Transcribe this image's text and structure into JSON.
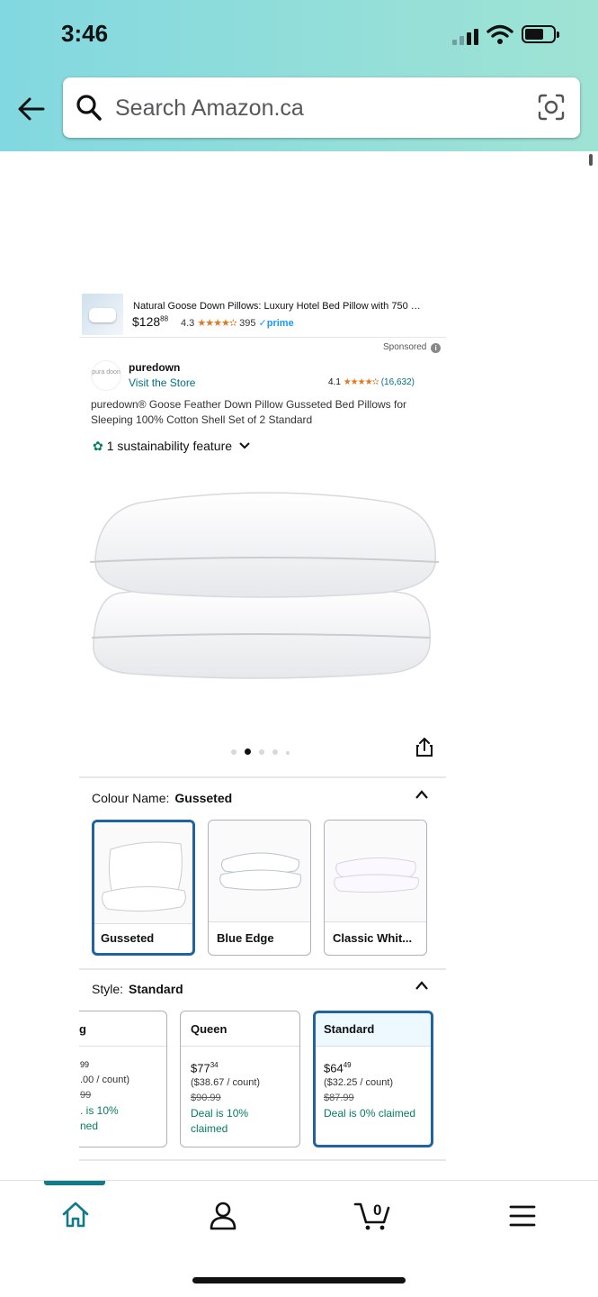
{
  "status_bar": {
    "time": "3:46"
  },
  "search": {
    "placeholder": "Search Amazon.ca"
  },
  "sponsored_ad": {
    "title": "Natural Goose Down Pillows: Luxury Hotel Bed Pillow with 750 …",
    "price_main": "$128",
    "price_cents": "88",
    "rating": "4.3",
    "stars": "★★★★✫",
    "review_count": "395",
    "prime_label": "✓prime"
  },
  "sponsored_label": "Sponsored",
  "brand": {
    "logo_text": "pura doon",
    "name": "puredown",
    "store_link": "Visit the Store",
    "rating": "4.1",
    "stars": "★★★★✫",
    "review_count": "(16,632)"
  },
  "product": {
    "title": "puredown® Goose Feather Down Pillow Gusseted Bed Pillows for Sleeping 100% Cotton Shell Set of 2 Standard",
    "sustainability": "1 sustainability feature"
  },
  "image_carousel": {
    "count": 5,
    "active_index": 1
  },
  "colour": {
    "label": "Colour Name:",
    "selected": "Gusseted",
    "options": [
      "Gusseted",
      "Blue Edge",
      "Classic Whit..."
    ]
  },
  "style": {
    "label": "Style:",
    "selected": "Standard",
    "options": [
      {
        "name": "g",
        "price": "99",
        "unit": ".00 / count)",
        "list": "99",
        "deal1": ". is 10%",
        "deal2": "ned"
      },
      {
        "name": "Queen",
        "price": "$77",
        "cents": "34",
        "unit": "($38.67 / count)",
        "list": "$90.99",
        "deal1": "Deal is 10%",
        "deal2": "claimed"
      },
      {
        "name": "Standard",
        "price": "$64",
        "cents": "49",
        "unit": "($32.25 / count)",
        "list": "$87.99",
        "deal1": "Deal is 0% claimed",
        "deal2": ""
      }
    ]
  },
  "bottom_nav": {
    "items": [
      "home",
      "account",
      "cart",
      "menu"
    ],
    "cart_count": "0"
  },
  "colors": {
    "accent": "#007185",
    "selected_border": "#2162a1",
    "deal": "#067d62",
    "star": "#de7921",
    "prime": "#1a98ff"
  }
}
